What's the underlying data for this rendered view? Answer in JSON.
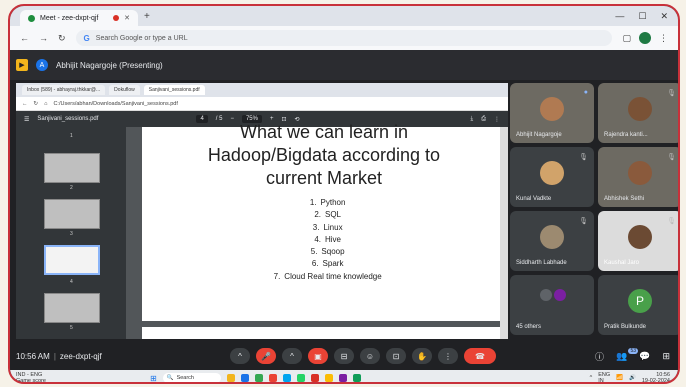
{
  "browser": {
    "tab_title": "Meet - zee-dxpt-qjf",
    "new_tab": "+",
    "url_placeholder": "Search Google or type a URL"
  },
  "meet": {
    "presenter_initial": "A",
    "presenter_label": "Abhijit Nagargoje (Presenting)"
  },
  "shared_window": {
    "tabs": [
      "Inbox (589) - abhayraj.thkkar@...",
      "Dokuflow",
      "Sanjivani_sessions.pdf"
    ],
    "url": "C:/Users/abhan/Downloads/Sanjivani_sessions.pdf",
    "pdf_name": "Sanjivani_sessions.pdf",
    "page_current": "4",
    "page_total": "/ 5",
    "zoom": "75%",
    "thumb_numbers": [
      "1",
      "2",
      "3",
      "4",
      "5"
    ]
  },
  "slide": {
    "title_line1": "What we can learn in",
    "title_line2": "Hadoop/Bigdata according to",
    "title_line3": "current Market",
    "items": [
      {
        "n": "1.",
        "text": "Python"
      },
      {
        "n": "2.",
        "text": "SQL"
      },
      {
        "n": "3.",
        "text": "Linux"
      },
      {
        "n": "4.",
        "text": "Hive"
      },
      {
        "n": "5.",
        "text": "Sqoop"
      },
      {
        "n": "6.",
        "text": "Spark"
      },
      {
        "n": "7.",
        "text": "Cloud Real time knowledge"
      }
    ]
  },
  "participants": [
    {
      "name": "Abhijit Nagargoje"
    },
    {
      "name": "Rajendra kanti..."
    },
    {
      "name": "Kunal Vadkte"
    },
    {
      "name": "Abhishek Sethi"
    },
    {
      "name": "Siddharth Labhade"
    },
    {
      "name": "Kaushal Jaro"
    },
    {
      "name": "45 others"
    },
    {
      "name": "Pratik Bulkunde",
      "initial": "P"
    }
  ],
  "bottom": {
    "time": "10:56 AM",
    "separator": "|",
    "meeting_code": "zee-dxpt-qjf",
    "participant_count": "53"
  },
  "taskbar": {
    "lang_top": "IND - ENG",
    "lang_bottom": "Game score",
    "search_label": "Search",
    "input_lang": "ENG",
    "input_region": "IN",
    "clock_time": "10:56",
    "clock_date": "19-02-2024"
  },
  "colors": {
    "frame_border": "#c8313a",
    "meet_bg": "#202124",
    "end_call": "#ea4335",
    "pratik_avatar": "#49a04a"
  }
}
